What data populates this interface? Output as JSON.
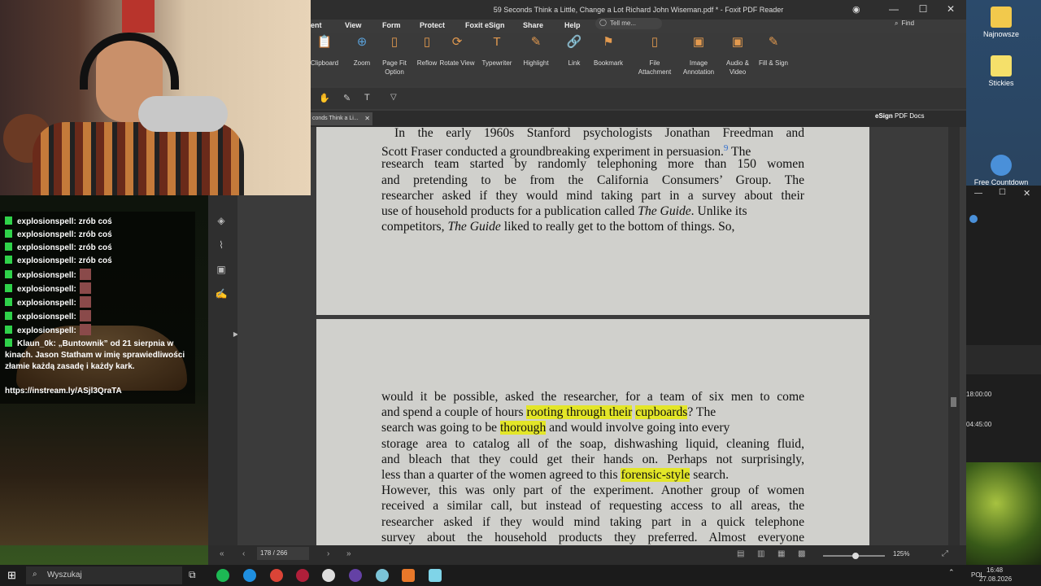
{
  "window": {
    "title": "59 Seconds Think a Little, Change a Lot Richard John Wiseman.pdf * - Foxit PDF Reader",
    "controls": [
      "—",
      "☐",
      "✕"
    ]
  },
  "menu": [
    "ent",
    "View",
    "Form",
    "Protect",
    "Foxit eSign",
    "Share",
    "Help"
  ],
  "tellme": "Tell me...",
  "find": "Find",
  "ribbon": [
    {
      "label": "Clipboard",
      "icon": "clipboard-icon",
      "glyph": "📋"
    },
    {
      "label": "Zoom",
      "icon": "zoom-icon",
      "glyph": "⊕"
    },
    {
      "label": "Page Fit Option",
      "icon": "page-fit-icon",
      "glyph": "▯"
    },
    {
      "label": "Reflow",
      "icon": "reflow-icon",
      "glyph": "▯"
    },
    {
      "label": "Rotate View",
      "icon": "rotate-icon",
      "glyph": "⟳"
    },
    {
      "label": "Typewriter",
      "icon": "typewriter-icon",
      "glyph": "T"
    },
    {
      "label": "Highlight",
      "icon": "highlight-icon",
      "glyph": "✎"
    },
    {
      "label": "Link",
      "icon": "link-icon",
      "glyph": "🔗"
    },
    {
      "label": "Bookmark",
      "icon": "bookmark-icon",
      "glyph": "⚑"
    },
    {
      "label": "File Attachment",
      "icon": "file-attachment-icon",
      "glyph": "▯"
    },
    {
      "label": "Image Annotation",
      "icon": "image-annotation-icon",
      "glyph": "▣"
    },
    {
      "label": "Audio & Video",
      "icon": "audio-video-icon",
      "glyph": "▣"
    },
    {
      "label": "Fill & Sign",
      "icon": "fill-sign-icon",
      "glyph": "✎"
    }
  ],
  "tab": {
    "label": "conds Think a Li..."
  },
  "esign": {
    "label": "eSign",
    "suffix": "PDF Docs"
  },
  "page1_lines": [
    "In the early 1960s Stanford psychologists Jonathan Freedman and",
    "Scott Fraser conducted a groundbreaking experiment in persuasion.",
    "research team started by randomly telephoning more than 150 women",
    "and pretending to be from the California Consumers’ Group. The",
    "researcher asked if they would mind taking part in a survey about their",
    "use of household products for a publication called",
    "competitors,",
    "liked to really get to the bottom of things. So,"
  ],
  "page1_ref": "9",
  "page1_line2_tail": "The",
  "page1_line6_em": "The Guide",
  "page1_line6_tail": ". Unlike its",
  "page1_line7_em": "The Guide",
  "page2": {
    "l1": "would it be possible, asked the researcher, for a team of six men to come",
    "l2a": "and spend a couple of hours",
    "l2h1": "rooting through their",
    "l2h2": "cupboards",
    "l2b": "? The",
    "l3a": "search was going to be",
    "l3h": "thorough",
    "l3b": "and would involve going into every",
    "l4": "storage area to catalog all of the soap, dishwashing liquid, cleaning fluid,",
    "l5": "and bleach that they could get their hands on. Perhaps not surprisingly,",
    "l6a": "less than a quarter of the women agreed to this",
    "l6h": "forensic-style",
    "l6b": "search.",
    "l7": "However, this was only part of the experiment. Another group of women",
    "l8": "received a similar call, but instead of requesting access to all areas, the",
    "l9": "researcher asked if they would mind taking part in a quick telephone",
    "l10": "survey about the household products they preferred. Almost everyone"
  },
  "status": {
    "page": "178 / 266",
    "zoom": "125%"
  },
  "chat": {
    "messages": [
      {
        "user": "explosionspell:",
        "text": "zrób coś"
      },
      {
        "user": "explosionspell:",
        "text": "zrób coś"
      },
      {
        "user": "explosionspell:",
        "text": "zrób coś"
      },
      {
        "user": "explosionspell:",
        "text": "zrób coś"
      },
      {
        "user": "explosionspell:",
        "text": ""
      },
      {
        "user": "explosionspell:",
        "text": ""
      },
      {
        "user": "explosionspell:",
        "text": ""
      },
      {
        "user": "explosionspell:",
        "text": ""
      },
      {
        "user": "explosionspell:",
        "text": ""
      }
    ],
    "promo_user": "Klaun_0k:",
    "promo_text": "„Buntownik” od 21 sierpnia w kinach. Jason Statham w imię sprawiedliwości złamie każdą zasadę i każdy kark.",
    "promo_link": "https://instream.ly/ASjl3QraTA"
  },
  "desktop": {
    "icons": [
      {
        "label": "Najnowsze",
        "color": "#f2c94c"
      },
      {
        "label": "Stickies",
        "color": "#f5e06a"
      },
      {
        "label": "Free Countdown",
        "color": "#4a90d9"
      }
    ],
    "countdown_times": [
      "18:00:00",
      "04:45:00"
    ]
  },
  "taskbar": {
    "search_placeholder": "Wyszukaj",
    "lang": "POL",
    "time": "16:48",
    "date": "27.08.2026"
  }
}
